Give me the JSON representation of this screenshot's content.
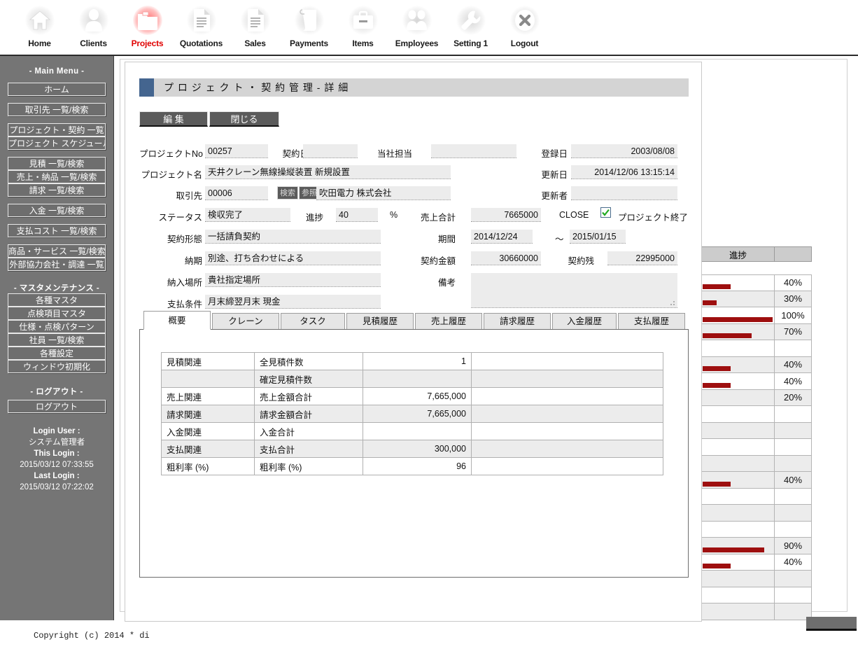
{
  "topnav": {
    "items": [
      {
        "label": "Home",
        "icon": "home-icon",
        "active": false
      },
      {
        "label": "Clients",
        "icon": "person-icon",
        "active": false
      },
      {
        "label": "Projects",
        "icon": "folder-icon",
        "active": true
      },
      {
        "label": "Quotations",
        "icon": "document-lines-icon",
        "active": false
      },
      {
        "label": "Sales",
        "icon": "document-lines-icon",
        "active": false
      },
      {
        "label": "Payments",
        "icon": "scroll-icon",
        "active": false
      },
      {
        "label": "Items",
        "icon": "briefcase-icon",
        "active": false
      },
      {
        "label": "Employees",
        "icon": "people-group-icon",
        "active": false
      },
      {
        "label": "Setting 1",
        "icon": "wrench-icon",
        "active": false
      },
      {
        "label": "Logout",
        "icon": "close-circle-icon",
        "active": false
      }
    ]
  },
  "sidebar": {
    "heading": "- Main Menu -",
    "groups": [
      [
        "ホーム"
      ],
      [
        "取引先 一覧/検索"
      ],
      [
        "プロジェクト・契約 一覧",
        "プロジェクト スケジュール"
      ],
      [
        "見積 一覧/検索",
        "売上・納品 一覧/検索",
        "請求 一覧/検索"
      ],
      [
        "入金 一覧/検索"
      ],
      [
        "支払コスト 一覧/検索"
      ],
      [
        "商品・サービス 一覧/検索",
        "外部協力会社・調達 一覧"
      ]
    ],
    "master_heading": "- マスタメンテナンス -",
    "master_items": [
      "各種マスタ",
      "点検項目マスタ",
      "仕様・点検パターン",
      "社員 一覧/検索",
      "各種設定",
      "ウィンドウ初期化"
    ],
    "logout_heading": "- ログアウト -",
    "logout_item": "ログアウト",
    "login": {
      "user_label": "Login User :",
      "user_value": "システム管理者",
      "this_label": "This Login :",
      "this_value": "2015/03/12 07:33:55",
      "last_label": "Last Login :",
      "last_value": "2015/03/12 07:22:02"
    }
  },
  "footer": {
    "copyright": "Copyright (c) 2014 * di"
  },
  "modal": {
    "title": "プ ロ ジ ェ ク ト  ・ 契 約 管 理 - 詳 細",
    "buttons": {
      "edit": "編 集",
      "close": "閉じる"
    },
    "form": {
      "project_no_label": "プロジェクトNo",
      "project_no_value": "00257",
      "contract_date_label": "契約日",
      "contract_date_value": "",
      "our_staff_label": "当社担当",
      "our_staff_value": "",
      "reg_date_label": "登録日",
      "reg_date_value": "2003/08/08",
      "project_name_label": "プロジェクト名",
      "project_name_value": "天井クレーン無線操縦装置 新規設置",
      "upd_date_label": "更新日",
      "upd_date_value": "2014/12/06 13:15:14",
      "client_label": "取引先",
      "client_code_value": "00006",
      "search_btn": "検索",
      "ref_btn": "参照",
      "client_name_value": "吹田電力 株式会社",
      "updater_label": "更新者",
      "updater_value": "",
      "status_label": "ステータス",
      "status_value": "検収完了",
      "progress_label": "進捗",
      "progress_value": "40",
      "percent_sign": "%",
      "sales_total_label": "売上合計",
      "sales_total_value": "7665000",
      "close_label": "CLOSE",
      "close_checked": true,
      "close_text": "プロジェクト終了",
      "contract_type_label": "契約形態",
      "contract_type_value": "一括請負契約",
      "period_label": "期間",
      "period_from": "2014/12/24",
      "period_sep": "～",
      "period_to": "2015/01/15",
      "delivery_label": "納期",
      "delivery_value": "別途、打ち合わせによる",
      "contract_amount_label": "契約金額",
      "contract_amount_value": "30660000",
      "contract_balance_label": "契約残",
      "contract_balance_value": "22995000",
      "delivery_place_label": "納入場所",
      "delivery_place_value": "貴社指定場所",
      "remarks_label": "備考",
      "remarks_value": "",
      "payment_terms_label": "支払条件",
      "payment_terms_value": "月末締翌月末 現金"
    },
    "tabs": [
      {
        "label": "概要",
        "active": true
      },
      {
        "label": "クレーン",
        "active": false
      },
      {
        "label": "タスク",
        "active": false
      },
      {
        "label": "見積履歴",
        "active": false
      },
      {
        "label": "売上履歴",
        "active": false
      },
      {
        "label": "請求履歴",
        "active": false
      },
      {
        "label": "入金履歴",
        "active": false
      },
      {
        "label": "支払履歴",
        "active": false
      }
    ],
    "summary_rows": [
      {
        "cat": "見積関連",
        "item": "全見積件数",
        "value": "1",
        "extra": "",
        "alt": false
      },
      {
        "cat": "",
        "item": "確定見積件数",
        "value": "",
        "extra": "",
        "alt": true
      },
      {
        "cat": "売上関連",
        "item": "売上金額合計",
        "value": "7,665,000",
        "extra": "",
        "alt": false
      },
      {
        "cat": "請求関連",
        "item": "請求金額合計",
        "value": "7,665,000",
        "extra": "",
        "alt": true
      },
      {
        "cat": "入金関連",
        "item": "入金合計",
        "value": "",
        "extra": "",
        "alt": false
      },
      {
        "cat": "支払関連",
        "item": "支払合計",
        "value": "300,000",
        "extra": "",
        "alt": true
      },
      {
        "cat": "粗利率 (%)",
        "item": "粗利率 (%)",
        "value": "96",
        "extra": "",
        "alt": false
      }
    ]
  },
  "progress_panel": {
    "header": "進捗",
    "rows": [
      {
        "pct": "40%",
        "bar": 40,
        "alt": false
      },
      {
        "pct": "30%",
        "bar": 20,
        "alt": true
      },
      {
        "pct": "100%",
        "bar": 100,
        "alt": false
      },
      {
        "pct": "70%",
        "bar": 70,
        "alt": true
      },
      {
        "pct": "",
        "bar": 0,
        "alt": false
      },
      {
        "pct": "40%",
        "bar": 40,
        "alt": true
      },
      {
        "pct": "40%",
        "bar": 40,
        "alt": false
      },
      {
        "pct": "20%",
        "bar": 0,
        "alt": true
      },
      {
        "pct": "",
        "bar": 0,
        "alt": false
      },
      {
        "pct": "",
        "bar": 0,
        "alt": true
      },
      {
        "pct": "",
        "bar": 0,
        "alt": false
      },
      {
        "pct": "",
        "bar": 0,
        "alt": true
      },
      {
        "pct": "40%",
        "bar": 40,
        "alt": true
      },
      {
        "pct": "",
        "bar": 0,
        "alt": false
      },
      {
        "pct": "",
        "bar": 0,
        "alt": true
      },
      {
        "pct": "",
        "bar": 0,
        "alt": false
      },
      {
        "pct": "90%",
        "bar": 88,
        "alt": true
      },
      {
        "pct": "40%",
        "bar": 40,
        "alt": false
      },
      {
        "pct": "",
        "bar": 0,
        "alt": true
      },
      {
        "pct": "",
        "bar": 0,
        "alt": false
      },
      {
        "pct": "",
        "bar": 0,
        "alt": true
      }
    ]
  },
  "colors": {
    "accent_blue": "#44658f",
    "bar_red": "#9e0f0f",
    "active_nav": "#e00000",
    "sidebar_bg": "#757575"
  }
}
